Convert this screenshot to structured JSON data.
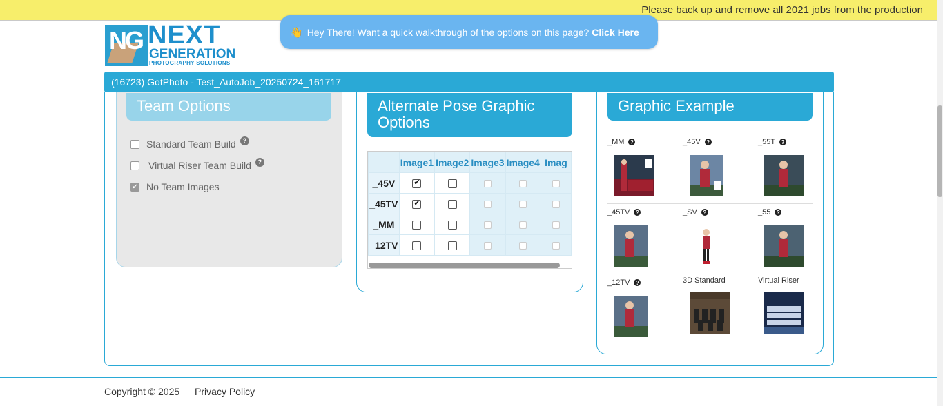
{
  "banner": {
    "text": "Please back up and remove all 2021 jobs from the production"
  },
  "walkthrough": {
    "emoji": "👋",
    "text": "Hey There! Want a quick walkthrough of the options on this page?",
    "link": "Click Here"
  },
  "logo": {
    "next": "NEXT",
    "generation": "GENERATION",
    "sub": "PHOTOGRAPHY SOLUTIONS",
    "mark": "NG"
  },
  "job": {
    "title": "(16723) GotPhoto - Test_AutoJob_20250724_161717"
  },
  "team_options": {
    "title": "Team Options",
    "items": [
      {
        "label": "Standard Team Build",
        "checked": false
      },
      {
        "label": "Virtual Riser Team Build",
        "checked": false
      },
      {
        "label": "No Team Images",
        "checked": true
      }
    ]
  },
  "pose_options": {
    "title": "Alternate Pose Graphic Options",
    "columns": [
      "Image1",
      "Image2",
      "Image3",
      "Image4",
      "Imag"
    ],
    "rows": [
      {
        "label": "_45V",
        "checks": [
          true,
          false
        ]
      },
      {
        "label": "_45TV",
        "checks": [
          true,
          false
        ]
      },
      {
        "label": "_MM",
        "checks": [
          false,
          false
        ]
      },
      {
        "label": "_12TV",
        "checks": [
          false,
          false
        ]
      }
    ]
  },
  "graphic_example": {
    "title": "Graphic Example",
    "items": [
      {
        "label": "_MM",
        "help": true
      },
      {
        "label": "_45V",
        "help": true
      },
      {
        "label": "_55T",
        "help": true
      },
      {
        "label": "_45TV",
        "help": true
      },
      {
        "label": "_SV",
        "help": true
      },
      {
        "label": "_55",
        "help": true
      },
      {
        "label": "_12TV",
        "help": true
      },
      {
        "label": "3D Standard",
        "help": false
      },
      {
        "label": "Virtual Riser",
        "help": false
      }
    ]
  },
  "footer": {
    "copyright": "Copyright © 2025",
    "privacy": "Privacy Policy"
  }
}
